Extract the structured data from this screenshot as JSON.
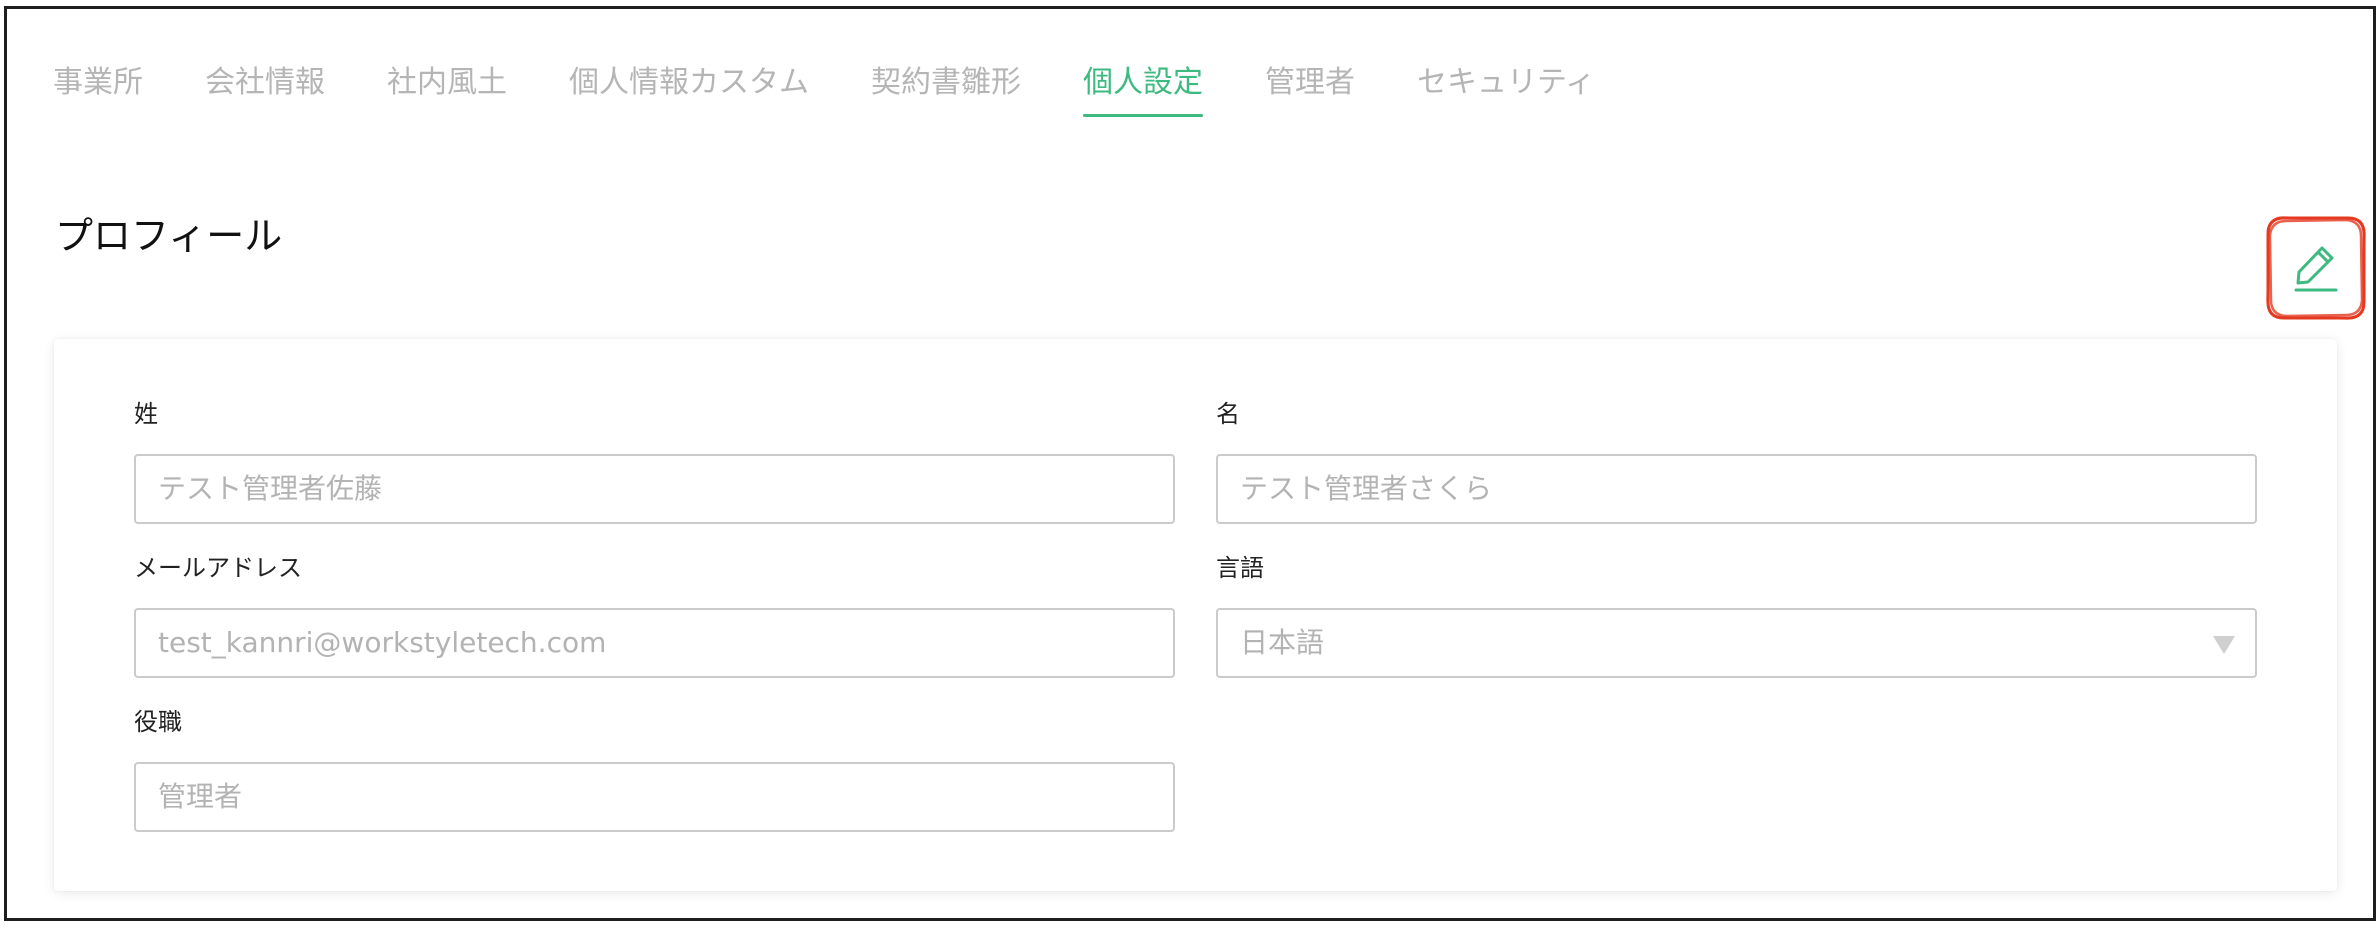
{
  "tabs": [
    {
      "label": "事業所"
    },
    {
      "label": "会社情報"
    },
    {
      "label": "社内風土"
    },
    {
      "label": "個人情報カスタム"
    },
    {
      "label": "契約書雛形"
    },
    {
      "label": "個人設定",
      "active": true
    },
    {
      "label": "管理者"
    },
    {
      "label": "セキュリティ"
    }
  ],
  "section": {
    "title": "プロフィール"
  },
  "edit": {
    "icon": "pencil-icon",
    "highlight": "red-circle"
  },
  "form": {
    "last_name": {
      "label": "姓",
      "value": "テスト管理者佐藤"
    },
    "first_name": {
      "label": "名",
      "value": "テスト管理者さくら"
    },
    "email": {
      "label": "メールアドレス",
      "value": "test_kannri@workstyletech.com"
    },
    "language": {
      "label": "言語",
      "value": "日本語",
      "icon": "caret-down-icon"
    },
    "position": {
      "label": "役職",
      "value": "管理者"
    }
  },
  "colors": {
    "accent": "#3dba7f",
    "annotation": "#e53a22",
    "muted": "#b5b5b5"
  }
}
